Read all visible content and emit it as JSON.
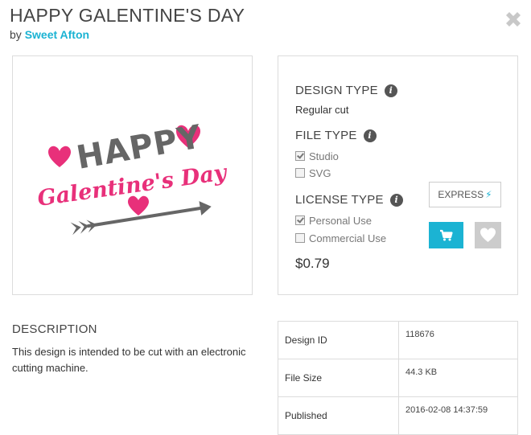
{
  "header": {
    "title": "HAPPY GALENTINE'S DAY",
    "by_prefix": "by",
    "author": "Sweet Afton"
  },
  "design_image": {
    "line1": "HAPPY",
    "line2": "Galentine's Day"
  },
  "design_type": {
    "heading": "DESIGN TYPE",
    "value": "Regular cut"
  },
  "file_type": {
    "heading": "FILE TYPE",
    "options": [
      {
        "label": "Studio",
        "checked": true
      },
      {
        "label": "SVG",
        "checked": false
      }
    ]
  },
  "license_type": {
    "heading": "LICENSE TYPE",
    "options": [
      {
        "label": "Personal Use",
        "checked": true
      },
      {
        "label": "Commercial Use",
        "checked": false
      }
    ]
  },
  "price": "$0.79",
  "buttons": {
    "express_label": "EXPRESS"
  },
  "description": {
    "heading": "DESCRIPTION",
    "text": "This design is intended to be cut with an electronic cutting machine."
  },
  "details": [
    {
      "label": "Design ID",
      "value": "118676"
    },
    {
      "label": "File Size",
      "value": "44.3 KB"
    },
    {
      "label": "Published",
      "value": "2016-02-08 14:37:59"
    }
  ],
  "colors": {
    "accent": "#1bb3d3",
    "pink": "#e8307a",
    "gray_text": "#666666"
  }
}
